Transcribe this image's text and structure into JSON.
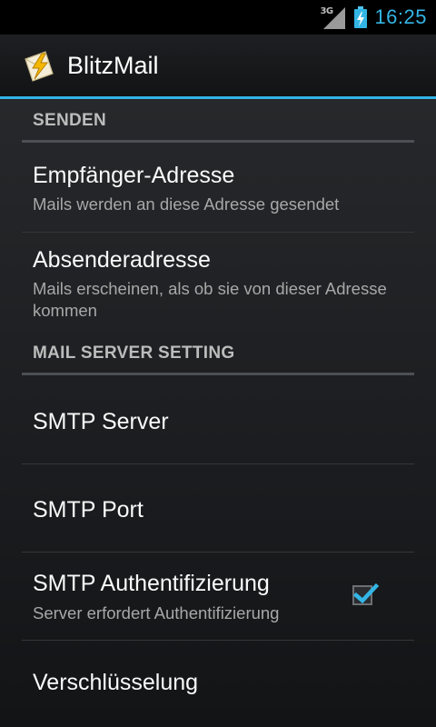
{
  "status_bar": {
    "network": "3G",
    "time": "16:25"
  },
  "action_bar": {
    "app_title": "BlitzMail",
    "app_icon": "lightning-mail-icon"
  },
  "sections": [
    {
      "header": "SENDEN",
      "items": [
        {
          "title": "Empfänger-Adresse",
          "summary": "Mails werden an diese Adresse gesendet"
        },
        {
          "title": "Absenderadresse",
          "summary": "Mails erscheinen, als ob sie von dieser Adresse kommen"
        }
      ]
    },
    {
      "header": "MAIL SERVER SETTING",
      "items": [
        {
          "title": "SMTP Server",
          "summary": ""
        },
        {
          "title": "SMTP Port",
          "summary": ""
        },
        {
          "title": "SMTP Authentifizierung",
          "summary": "Server erfordert Authentifizierung",
          "checked": true
        },
        {
          "title": "Verschlüsselung",
          "summary": ""
        }
      ]
    }
  ],
  "colors": {
    "accent": "#33b5e5",
    "background": "#1f2124",
    "text_primary": "#fafafa",
    "text_secondary": "#a8a8a8"
  }
}
